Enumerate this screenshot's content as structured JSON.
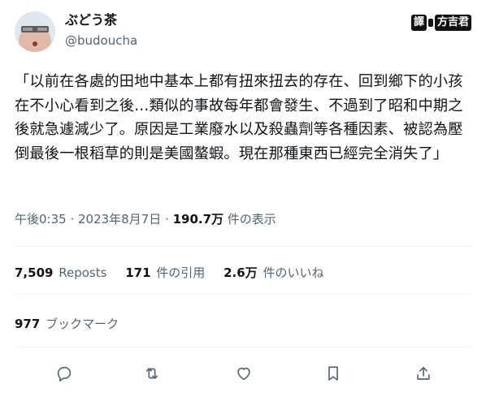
{
  "author": {
    "display_name": "ぶどう茶",
    "handle": "@budoucha"
  },
  "watermark": {
    "left": "譯",
    "right": "方吉君"
  },
  "tweet": {
    "text": "「以前在各處的田地中基本上都有扭來扭去的存在、回到鄉下的小孩在不小心看到之後…類似的事故每年都會發生、不過到了昭和中期之後就急遽減少了。原因是工業廢水以及殺蟲劑等各種因素、被認為壓倒最後一根稻草的則是美國螯蝦。現在那種東西已經完全消失了」"
  },
  "meta": {
    "time": "午後0:35",
    "separator": " · ",
    "date": "2023年8月7日",
    "views_count": "190.7万",
    "views_label": " 件の表示"
  },
  "stats": {
    "reposts_count": "7,509",
    "reposts_label": "Reposts",
    "quotes_count": "171",
    "quotes_label": "件の引用",
    "likes_count": "2.6万",
    "likes_label": "件のいいね"
  },
  "bookmarks": {
    "count": "977",
    "label": "ブックマーク"
  },
  "icons": [
    "reply-icon",
    "retweet-icon",
    "like-icon",
    "bookmark-icon",
    "share-icon"
  ]
}
